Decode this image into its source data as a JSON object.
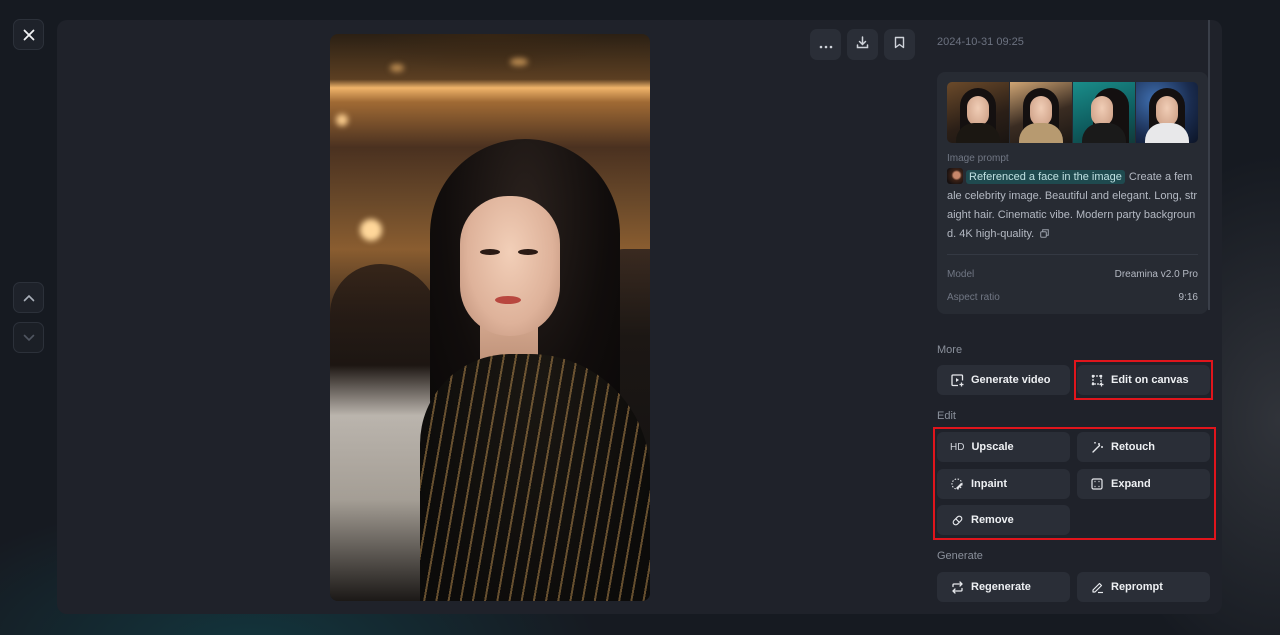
{
  "nav": {
    "close_icon": "close-icon",
    "prev_icon": "chevron-up-icon",
    "next_icon": "chevron-down-icon"
  },
  "toolbar": {
    "more_icon": "more-horizontal-icon",
    "download_icon": "download-icon",
    "bookmark_icon": "bookmark-icon"
  },
  "details": {
    "timestamp": "2024-10-31 09:25",
    "thumbnails": [
      "Variation 1",
      "Variation 2",
      "Variation 3",
      "Variation 4"
    ],
    "prompt_label": "Image prompt",
    "reference_chip": "Referenced a face in the image",
    "prompt_text": "Create a female celebrity image. Beautiful and elegant. Long, straight hair. Cinematic vibe. Modern party background. 4K high-quality.",
    "model_label": "Model",
    "model_value": "Dreamina v2.0 Pro",
    "aspect_label": "Aspect ratio",
    "aspect_value": "9:16"
  },
  "sections": {
    "more": {
      "label": "More",
      "buttons": [
        {
          "label": "Generate video",
          "icon": "video-generate-icon"
        },
        {
          "label": "Edit on canvas",
          "icon": "canvas-edit-icon"
        }
      ]
    },
    "edit": {
      "label": "Edit",
      "buttons": [
        {
          "label": "Upscale",
          "icon": "hd-icon",
          "prefix": "HD"
        },
        {
          "label": "Retouch",
          "icon": "magic-wand-icon"
        },
        {
          "label": "Inpaint",
          "icon": "inpaint-brush-icon"
        },
        {
          "label": "Expand",
          "icon": "expand-icon"
        },
        {
          "label": "Remove",
          "icon": "eraser-icon"
        }
      ]
    },
    "generate": {
      "label": "Generate",
      "buttons": [
        {
          "label": "Regenerate",
          "icon": "regenerate-icon"
        },
        {
          "label": "Reprompt",
          "icon": "pencil-icon"
        }
      ]
    }
  },
  "colors": {
    "highlight": "#e0151c",
    "chip_bg": "#1f4a4f",
    "modal_bg": "#1f222a",
    "button_bg": "#2a2e37"
  }
}
